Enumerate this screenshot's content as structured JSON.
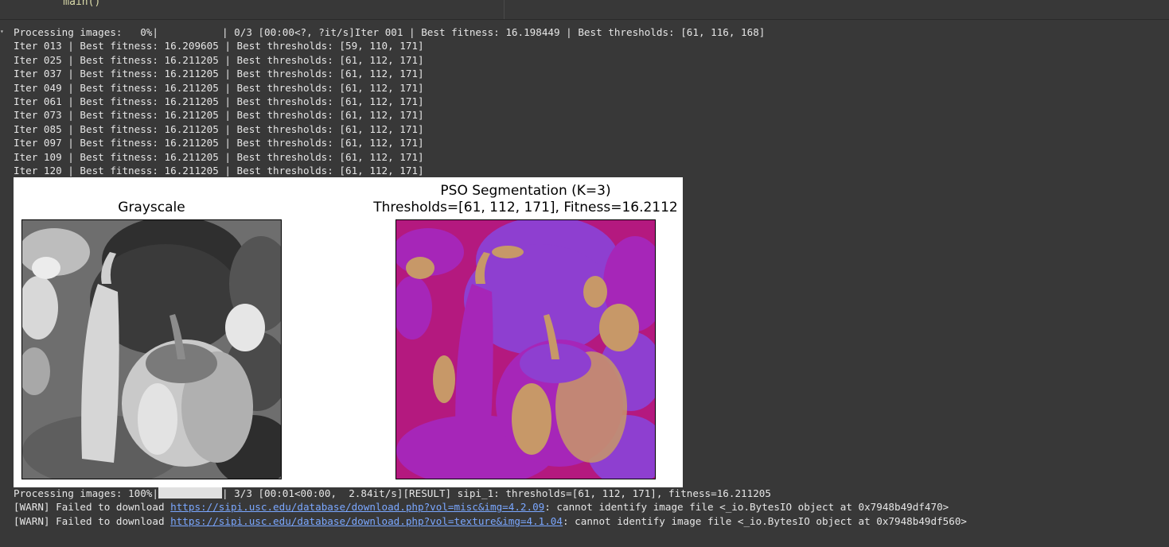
{
  "cell": {
    "code_text": "    main()"
  },
  "output": {
    "progress_start": {
      "prefix": "Processing images:   0%|",
      "suffix": "| 0/3 [00:00<?, ?it/s]Iter 001 | Best fitness: 16.198449 | Best thresholds: [61, 116, 168]"
    },
    "iter_lines": [
      "Iter 013 | Best fitness: 16.209605 | Best thresholds: [59, 110, 171]",
      "Iter 025 | Best fitness: 16.211205 | Best thresholds: [61, 112, 171]",
      "Iter 037 | Best fitness: 16.211205 | Best thresholds: [61, 112, 171]",
      "Iter 049 | Best fitness: 16.211205 | Best thresholds: [61, 112, 171]",
      "Iter 061 | Best fitness: 16.211205 | Best thresholds: [61, 112, 171]",
      "Iter 073 | Best fitness: 16.211205 | Best thresholds: [61, 112, 171]",
      "Iter 085 | Best fitness: 16.211205 | Best thresholds: [61, 112, 171]",
      "Iter 097 | Best fitness: 16.211205 | Best thresholds: [61, 112, 171]",
      "Iter 109 | Best fitness: 16.211205 | Best thresholds: [61, 112, 171]",
      "Iter 120 | Best fitness: 16.211205 | Best thresholds: [61, 112, 171]"
    ],
    "progress_end": {
      "prefix": "Processing images: 100%|",
      "suffix": "| 3/3 [00:01<00:00,  2.84it/s][RESULT] sipi_1: thresholds=[61, 112, 171], fitness=16.211205"
    },
    "warnings": [
      {
        "prefix": "[WARN] Failed to download ",
        "url": "https://sipi.usc.edu/database/download.php?vol=misc&img=4.2.09",
        "suffix": ": cannot identify image file <_io.BytesIO object at 0x7948b49df470>"
      },
      {
        "prefix": "[WARN] Failed to download ",
        "url": "https://sipi.usc.edu/database/download.php?vol=texture&img=4.1.04",
        "suffix": ": cannot identify image file <_io.BytesIO object at 0x7948b49df560>"
      }
    ]
  },
  "figure": {
    "left_title": "Grayscale",
    "right_title_line1": "PSO Segmentation (K=3)",
    "right_title_line2": "Thresholds=[61, 112, 171], Fitness=16.2112",
    "segment_colors": [
      "#b4197f",
      "#8e3fd0",
      "#c79868",
      "#a626b8"
    ]
  }
}
